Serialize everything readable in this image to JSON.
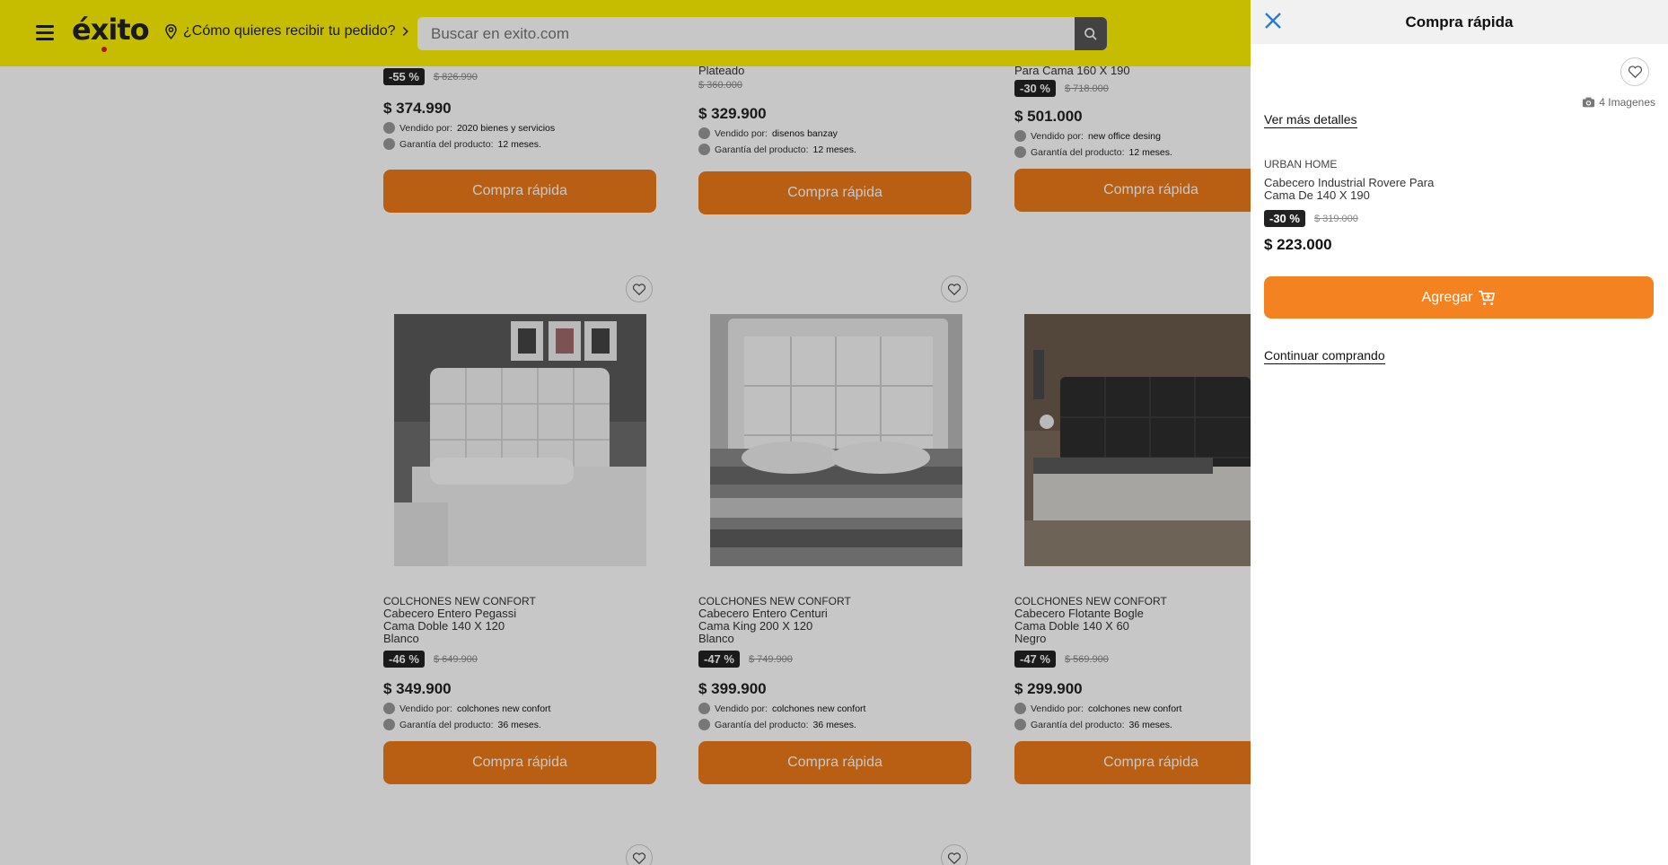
{
  "header": {
    "logo": "éxito",
    "location": "¿Cómo quieres recibir tu pedido?",
    "search_placeholder": "Buscar en exito.com"
  },
  "products_top": [
    {
      "title_tail": "",
      "badge": "-55 %",
      "old_price": "$ 826.990",
      "price": "$ 374.990",
      "seller_label": "Vendido por:",
      "seller": "2020 bienes y servicios",
      "warranty_label": "Garantía del producto:",
      "warranty": "12 meses.",
      "button": "Compra rápida"
    },
    {
      "title_tail": "Plateado",
      "badge": "",
      "old_price": "$ 360.000",
      "price": "$ 329.900",
      "seller_label": "Vendido por:",
      "seller": "disenos banzay",
      "warranty_label": "Garantía del producto:",
      "warranty": "12 meses.",
      "button": "Compra rápida"
    },
    {
      "title_tail": "Para Cama 160 X 190",
      "badge": "-30 %",
      "old_price": "$ 718.000",
      "price": "$ 501.000",
      "seller_label": "Vendido por:",
      "seller": "new office desing",
      "warranty_label": "Garantía del producto:",
      "warranty": "12 meses.",
      "button": "Compra rápida"
    }
  ],
  "products_mid": [
    {
      "brand": "COLCHONES NEW CONFORT",
      "name_lines": [
        "Cabecero Entero Pegassi",
        "Cama Doble 140 X 120",
        "Blanco"
      ],
      "badge": "-46 %",
      "old_price": "$ 649.900",
      "price": "$ 349.900",
      "seller_label": "Vendido por:",
      "seller": "colchones new confort",
      "warranty_label": "Garantía del producto:",
      "warranty": "36 meses.",
      "button": "Compra rápida"
    },
    {
      "brand": "COLCHONES NEW CONFORT",
      "name_lines": [
        "Cabecero Entero Centuri",
        "Cama King 200 X 120",
        "Blanco"
      ],
      "badge": "-47 %",
      "old_price": "$ 749.900",
      "price": "$ 399.900",
      "seller_label": "Vendido por:",
      "seller": "colchones new confort",
      "warranty_label": "Garantía del producto:",
      "warranty": "36 meses.",
      "button": "Compra rápida"
    },
    {
      "brand": "COLCHONES NEW CONFORT",
      "name_lines": [
        "Cabecero Flotante Bogle",
        "Cama Doble 140 X 60",
        "Negro"
      ],
      "badge": "-47 %",
      "old_price": "$ 569.900",
      "price": "$ 299.900",
      "seller_label": "Vendido por:",
      "seller": "colchones new confort",
      "warranty_label": "Garantía del producto:",
      "warranty": "36 meses.",
      "button": "Compra rápida"
    }
  ],
  "panel": {
    "title": "Compra rápida",
    "images_count": "4 Imagenes",
    "more_details": "Ver más detalles",
    "brand": "URBAN HOME",
    "name_lines": [
      "Cabecero Industrial Rovere Para",
      "Cama De 140 X 190"
    ],
    "badge": "-30 %",
    "old_price": "$ 319.000",
    "price": "$ 223.000",
    "add_button": "Agregar",
    "continue": "Continuar comprando"
  },
  "colors": {
    "header_yellow": "#fff200",
    "button_orange": "#ec7a19",
    "add_orange": "#f58220",
    "close_blue": "#2a7bd8"
  }
}
